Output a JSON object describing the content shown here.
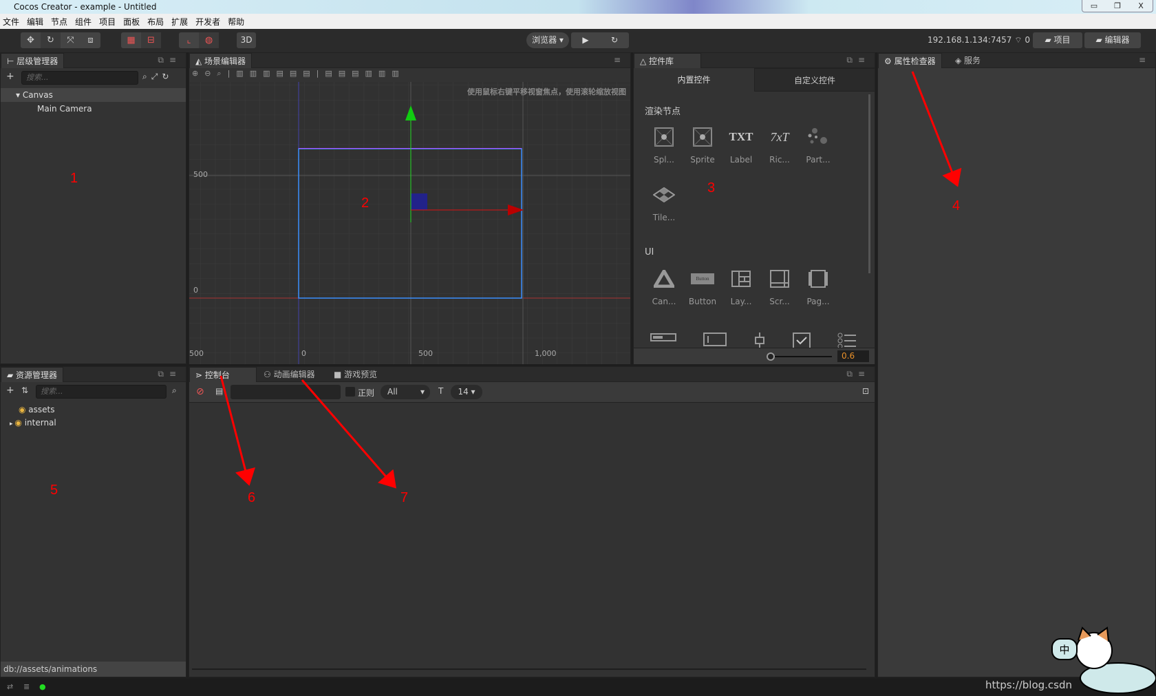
{
  "window": {
    "title": "Cocos Creator - example - Untitled",
    "controls": [
      "minimize",
      "restore",
      "close"
    ]
  },
  "menu": [
    "文件",
    "编辑",
    "节点",
    "组件",
    "项目",
    "面板",
    "布局",
    "扩展",
    "开发者",
    "帮助"
  ],
  "toolbar": {
    "mode_3d": "3D",
    "browser": "浏览器 ▾",
    "ip": "192.168.1.134:7457",
    "connections": "0",
    "project_btn": "项目",
    "editor_btn": "编辑器"
  },
  "hierarchy": {
    "tab": "层级管理器",
    "search_placeholder": "搜索...",
    "nodes": [
      {
        "label": "Canvas",
        "expanded": true
      },
      {
        "label": "Main Camera"
      }
    ]
  },
  "scene": {
    "tab": "场景编辑器",
    "hint": "使用鼠标右键平移视窗焦点，使用滚轮缩放视图",
    "y_ticks": [
      "500",
      "0"
    ],
    "x_ticks": [
      "500",
      "0",
      "500",
      "1,000"
    ]
  },
  "components": {
    "tab": "控件库",
    "subtabs": [
      "内置控件",
      "自定义控件"
    ],
    "render_section": "渲染节点",
    "render_items": [
      "Spl...",
      "Sprite",
      "Label",
      "Ric...",
      "Part...",
      "Tile..."
    ],
    "ui_section": "UI",
    "ui_items": [
      "Can...",
      "Button",
      "Lay...",
      "Scr...",
      "Pag..."
    ],
    "scale_value": "0.6",
    "scale_fraction": 0.0
  },
  "inspector": {
    "tabs": [
      "属性检查器",
      "服务"
    ]
  },
  "assets": {
    "tab": "资源管理器",
    "search_placeholder": "搜索...",
    "items": [
      {
        "label": "assets"
      },
      {
        "label": "internal",
        "collapsed": true
      }
    ],
    "path": "db://assets/animations"
  },
  "console": {
    "tabs": [
      "控制台",
      "动画编辑器",
      "游戏预览"
    ],
    "regex_label": "正则",
    "filter": "All",
    "font_size": "14 ▾"
  },
  "annotations": [
    "1",
    "2",
    "3",
    "4",
    "5",
    "6",
    "7"
  ],
  "watermark": "https://blog.csdn",
  "colors": {
    "annotation": "#ff0000",
    "accent": "#e8902a",
    "canvas_frame": "#3b8fff"
  }
}
